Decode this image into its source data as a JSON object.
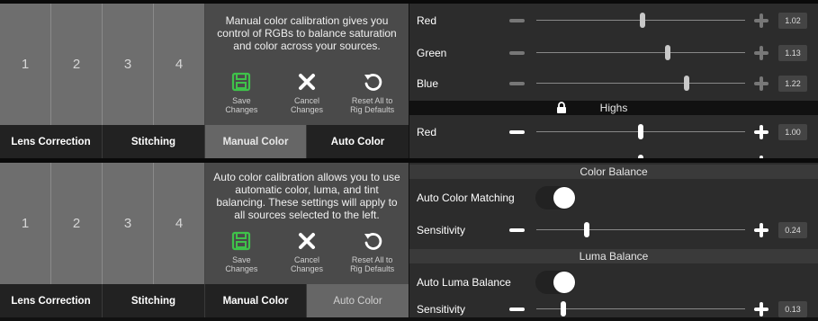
{
  "panel1": {
    "sources": [
      "1",
      "2",
      "3",
      "4"
    ],
    "info_text": "Manual color calibration gives you control of RGBs to balance saturation and color across your sources.",
    "actions": [
      {
        "icon": "save-icon",
        "label": "Save\nChanges"
      },
      {
        "icon": "close-icon",
        "label": "Cancel\nChanges"
      },
      {
        "icon": "undo-icon",
        "label": "Reset All to\nRig Defaults"
      }
    ],
    "tabs": [
      "Lens Correction",
      "Stitching",
      "Manual Color",
      "Auto Color"
    ],
    "active_tab": "Manual Color",
    "rows_top": [
      {
        "label": "Red",
        "value": "1.02",
        "level": 0.51
      },
      {
        "label": "Green",
        "value": "1.13",
        "level": 0.63
      },
      {
        "label": "Blue",
        "value": "1.22",
        "level": 0.72
      }
    ],
    "section": "Highs",
    "rows_bottom": [
      {
        "label": "Red",
        "value": "1.00",
        "level": 0.5
      }
    ]
  },
  "panel2": {
    "sources": [
      "1",
      "2",
      "3",
      "4"
    ],
    "info_text": "Auto color calibration allows you to use automatic color, luma, and tint balancing. These settings will apply to all sources selected to the left.",
    "actions": [
      {
        "icon": "save-icon",
        "label": "Save\nChanges"
      },
      {
        "icon": "close-icon",
        "label": "Cancel\nChanges"
      },
      {
        "icon": "undo-icon",
        "label": "Reset All to\nRig Defaults"
      }
    ],
    "tabs": [
      "Lens Correction",
      "Stitching",
      "Manual Color",
      "Auto Color"
    ],
    "active_tab": "Auto Color",
    "color_balance": {
      "title": "Color Balance",
      "toggle_label": "Auto Color Matching",
      "toggle_on": true,
      "sensitivity_label": "Sensitivity",
      "sensitivity_value": "0.24",
      "level": 0.24
    },
    "luma_balance": {
      "title": "Luma Balance",
      "toggle_label": "Auto Luma Balance",
      "toggle_on": true,
      "sensitivity_label": "Sensitivity",
      "sensitivity_value": "0.13",
      "level": 0.13
    }
  },
  "colors": {
    "save_icon": "#3fc24a",
    "active_tab_bg": "#666666",
    "panel_bg": "#2c2c2c"
  }
}
